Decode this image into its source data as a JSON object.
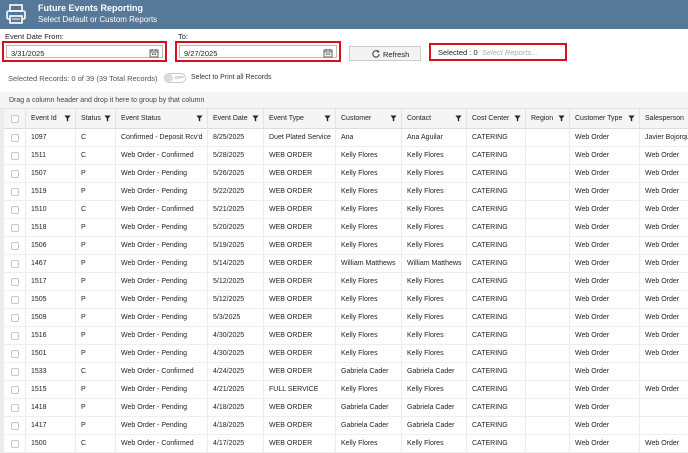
{
  "app": {
    "title": "Future Events Reporting",
    "subtitle": "Select Default or Custom Reports",
    "brand_color": "#56799a",
    "highlight_color": "#d6111d"
  },
  "filters": {
    "from_label": "Event Date From:",
    "from_value": "3/31/2025",
    "to_label": "To:",
    "to_value": "9/27/2025",
    "refresh_label": "Refresh",
    "selected_label": "Selected : 0",
    "reports_placeholder": "Select Reports..."
  },
  "records": {
    "summary": "Selected Records: 0 of 39 (39 Total Records)",
    "toggle_text": "OFF",
    "print_all_label": "Select to Print all Records"
  },
  "group_hint": "Drag a column header and drop it here to group by that column",
  "table": {
    "columns": [
      {
        "label": "Event Id",
        "filter": true
      },
      {
        "label": "Status",
        "filter": true
      },
      {
        "label": "Event Status",
        "filter": true
      },
      {
        "label": "Event Date",
        "filter": true
      },
      {
        "label": "Event Type",
        "filter": true
      },
      {
        "label": "Customer",
        "filter": true
      },
      {
        "label": "Contact",
        "filter": true
      },
      {
        "label": "Cost Center",
        "filter": true
      },
      {
        "label": "Region",
        "filter": true
      },
      {
        "label": "Customer Type",
        "filter": true
      },
      {
        "label": "Salesperson",
        "filter": false
      }
    ],
    "rows": [
      [
        "1097",
        "C",
        "Confirmed - Deposit Rcv'd",
        "8/25/2025",
        "Duet Plated Service",
        "Ana",
        "Ana Aguilar",
        "CATERING",
        "",
        "Web Order",
        "Javier Bojorquez"
      ],
      [
        "1511",
        "C",
        "Web Order - Confirmed",
        "5/28/2025",
        "WEB ORDER",
        "Kelly Flores",
        "Kelly Flores",
        "CATERING",
        "",
        "Web Order",
        "Web Order"
      ],
      [
        "1507",
        "P",
        "Web Order - Pending",
        "5/26/2025",
        "WEB ORDER",
        "Kelly Flores",
        "Kelly Flores",
        "CATERING",
        "",
        "Web Order",
        "Web Order"
      ],
      [
        "1519",
        "P",
        "Web Order - Pending",
        "5/22/2025",
        "WEB ORDER",
        "Kelly Flores",
        "Kelly Flores",
        "CATERING",
        "",
        "Web Order",
        "Web Order"
      ],
      [
        "1510",
        "C",
        "Web Order - Confirmed",
        "5/21/2025",
        "WEB ORDER",
        "Kelly Flores",
        "Kelly Flores",
        "CATERING",
        "",
        "Web Order",
        "Web Order"
      ],
      [
        "1518",
        "P",
        "Web Order - Pending",
        "5/20/2025",
        "WEB ORDER",
        "Kelly Flores",
        "Kelly Flores",
        "CATERING",
        "",
        "Web Order",
        "Web Order"
      ],
      [
        "1506",
        "P",
        "Web Order - Pending",
        "5/19/2025",
        "WEB ORDER",
        "Kelly Flores",
        "Kelly Flores",
        "CATERING",
        "",
        "Web Order",
        "Web Order"
      ],
      [
        "1467",
        "P",
        "Web Order - Pending",
        "5/14/2025",
        "WEB ORDER",
        "William Matthews",
        "William Matthews",
        "CATERING",
        "",
        "Web Order",
        "Web Order"
      ],
      [
        "1517",
        "P",
        "Web Order - Pending",
        "5/12/2025",
        "WEB ORDER",
        "Kelly Flores",
        "Kelly Flores",
        "CATERING",
        "",
        "Web Order",
        "Web Order"
      ],
      [
        "1505",
        "P",
        "Web Order - Pending",
        "5/12/2025",
        "WEB ORDER",
        "Kelly Flores",
        "Kelly Flores",
        "CATERING",
        "",
        "Web Order",
        "Web Order"
      ],
      [
        "1509",
        "P",
        "Web Order - Pending",
        "5/3/2025",
        "WEB ORDER",
        "Kelly Flores",
        "Kelly Flores",
        "CATERING",
        "",
        "Web Order",
        "Web Order"
      ],
      [
        "1516",
        "P",
        "Web Order - Pending",
        "4/30/2025",
        "WEB ORDER",
        "Kelly Flores",
        "Kelly Flores",
        "CATERING",
        "",
        "Web Order",
        "Web Order"
      ],
      [
        "1501",
        "P",
        "Web Order - Pending",
        "4/30/2025",
        "WEB ORDER",
        "Kelly Flores",
        "Kelly Flores",
        "CATERING",
        "",
        "Web Order",
        "Web Order"
      ],
      [
        "1533",
        "C",
        "Web Order - Confirmed",
        "4/24/2025",
        "WEB ORDER",
        "Gabriela Cader",
        "Gabriela Cader",
        "CATERING",
        "",
        "Web Order",
        ""
      ],
      [
        "1515",
        "P",
        "Web Order - Pending",
        "4/21/2025",
        "FULL SERVICE",
        "Kelly Flores",
        "Kelly Flores",
        "CATERING",
        "",
        "Web Order",
        "Web Order"
      ],
      [
        "1418",
        "P",
        "Web Order - Pending",
        "4/18/2025",
        "WEB ORDER",
        "Gabriela Cader",
        "Gabriela Cader",
        "CATERING",
        "",
        "Web Order",
        ""
      ],
      [
        "1417",
        "P",
        "Web Order - Pending",
        "4/18/2025",
        "WEB ORDER",
        "Gabriela Cader",
        "Gabriela Cader",
        "CATERING",
        "",
        "Web Order",
        ""
      ],
      [
        "1500",
        "C",
        "Web Order - Confirmed",
        "4/17/2025",
        "WEB ORDER",
        "Kelly Flores",
        "Kelly Flores",
        "CATERING",
        "",
        "Web Order",
        "Web Order"
      ]
    ]
  }
}
